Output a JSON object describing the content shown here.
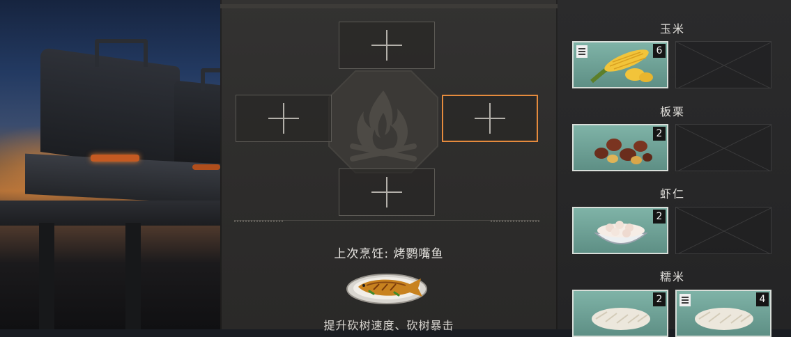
{
  "categories": [
    {
      "title": "玉米",
      "items": [
        {
          "name": "corn",
          "count": "6",
          "bookmark": true
        }
      ]
    },
    {
      "title": "板栗",
      "items": [
        {
          "name": "chestnut",
          "count": "2",
          "bookmark": false
        }
      ]
    },
    {
      "title": "虾仁",
      "items": [
        {
          "name": "shrimp",
          "count": "2",
          "bookmark": false
        }
      ]
    },
    {
      "title": "糯米",
      "items": [
        {
          "name": "rice-a",
          "count": "2",
          "bookmark": false
        },
        {
          "name": "rice-b",
          "count": "4",
          "bookmark": true
        }
      ]
    }
  ],
  "cooking": {
    "last_cook": "上次烹饪: 烤鹦嘴鱼",
    "effect": "提升砍树速度、砍树暴击"
  },
  "colors": {
    "accent": "#e58b3d",
    "item_bg": "#6fa497",
    "panel": "#2f2e2d"
  },
  "icons": [
    "plus-icon",
    "fire-icon",
    "bookmark-icon",
    "fish-dish-icon",
    "corn-icon",
    "chestnut-icon",
    "shrimp-icon",
    "rice-icon"
  ]
}
